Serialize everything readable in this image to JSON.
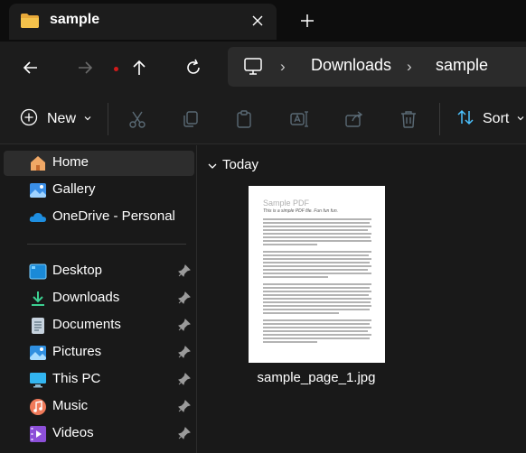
{
  "window": {
    "tab_title": "sample",
    "tab_icon": "folder-icon",
    "close_icon": "close-icon",
    "new_tab_icon": "plus-icon"
  },
  "navigation": {
    "back_icon": "arrow-left-icon",
    "forward_icon": "arrow-right-icon",
    "up_icon": "arrow-up-icon",
    "refresh_icon": "refresh-icon",
    "breadcrumb": [
      "Downloads",
      "sample"
    ]
  },
  "toolbar": {
    "new_label": "New",
    "sort_label": "Sort",
    "icons": [
      "cut-icon",
      "copy-icon",
      "paste-icon",
      "rename-icon",
      "share-icon",
      "delete-icon"
    ]
  },
  "sidebar": {
    "items": [
      {
        "label": "Home",
        "icon": "home-icon",
        "selected": true
      },
      {
        "label": "Gallery",
        "icon": "gallery-icon"
      },
      {
        "label": "OneDrive - Personal",
        "icon": "onedrive-icon"
      }
    ],
    "pinned": [
      {
        "label": "Desktop",
        "icon": "desktop-icon"
      },
      {
        "label": "Downloads",
        "icon": "downloads-icon"
      },
      {
        "label": "Documents",
        "icon": "documents-icon"
      },
      {
        "label": "Pictures",
        "icon": "pictures-icon"
      },
      {
        "label": "This PC",
        "icon": "this-pc-icon"
      },
      {
        "label": "Music",
        "icon": "music-icon"
      },
      {
        "label": "Videos",
        "icon": "videos-icon"
      }
    ]
  },
  "content": {
    "group_label": "Today",
    "files": [
      {
        "name": "sample_page_1.jpg",
        "thumbnail_title": "Sample PDF",
        "thumbnail_subtitle": "This is a simple PDF file. Fun fun fun."
      }
    ]
  },
  "colors": {
    "accent": "#4cc2ff",
    "folder": "#f4c24b",
    "background": "#191919",
    "selected": "#2d2d2d"
  }
}
